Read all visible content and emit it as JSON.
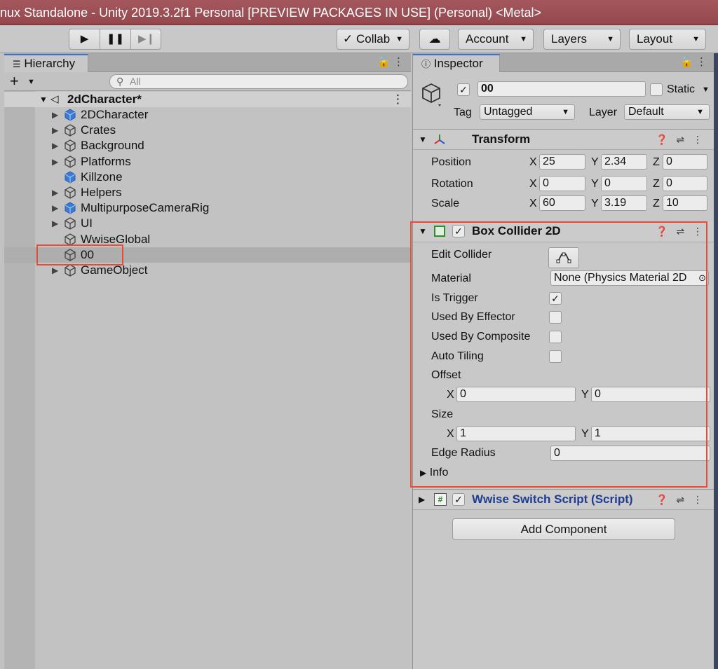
{
  "window": {
    "title": "nux Standalone - Unity 2019.3.2f1 Personal [PREVIEW PACKAGES IN USE] (Personal) <Metal>"
  },
  "toolbar": {
    "play_icon": "play-icon",
    "pause_icon": "pause-icon",
    "step_icon": "step-icon",
    "collab": "Collab",
    "cloud_icon": "cloud-icon",
    "account": "Account",
    "layers": "Layers",
    "layout": "Layout"
  },
  "hierarchy": {
    "tab": "Hierarchy",
    "search_placeholder": "All",
    "scene": "2dCharacter*",
    "items": [
      {
        "label": "2DCharacter",
        "icon": "blue-cube-icon",
        "fold": true
      },
      {
        "label": "Crates",
        "icon": "cube-outline-icon",
        "fold": true
      },
      {
        "label": "Background",
        "icon": "cube-outline-icon",
        "fold": true
      },
      {
        "label": "Platforms",
        "icon": "cube-outline-icon",
        "fold": true
      },
      {
        "label": "Killzone",
        "icon": "blue-cube-icon",
        "fold": false
      },
      {
        "label": "Helpers",
        "icon": "cube-outline-icon",
        "fold": true
      },
      {
        "label": "MultipurposeCameraRig",
        "icon": "blue-cube-icon",
        "fold": true
      },
      {
        "label": "UI",
        "icon": "cube-outline-icon",
        "fold": true
      },
      {
        "label": "WwiseGlobal",
        "icon": "cube-outline-icon",
        "fold": false
      },
      {
        "label": "00",
        "icon": "cube-outline-icon",
        "fold": false
      },
      {
        "label": "GameObject",
        "icon": "cube-outline-icon",
        "fold": true
      }
    ]
  },
  "inspector": {
    "tab": "Inspector",
    "name": "00",
    "static": "Static",
    "tag_label": "Tag",
    "tag": "Untagged",
    "layer_label": "Layer",
    "layer": "Default",
    "transform": {
      "title": "Transform",
      "position": {
        "label": "Position",
        "x": "25",
        "y": "2.34",
        "z": "0"
      },
      "rotation": {
        "label": "Rotation",
        "x": "0",
        "y": "0",
        "z": "0"
      },
      "scale": {
        "label": "Scale",
        "x": "60",
        "y": "3.19",
        "z": "10"
      }
    },
    "box_collider": {
      "title": "Box Collider 2D",
      "edit_collider": "Edit Collider",
      "material_label": "Material",
      "material": "None (Physics Material 2D",
      "is_trigger": "Is Trigger",
      "used_by_effector": "Used By Effector",
      "used_by_composite": "Used By Composite",
      "auto_tiling": "Auto Tiling",
      "offset": "Offset",
      "offset_x": "0",
      "offset_y": "0",
      "size": "Size",
      "size_x": "1",
      "size_y": "1",
      "edge_radius_label": "Edge Radius",
      "edge_radius": "0",
      "info": "Info"
    },
    "script": {
      "title": "Wwise Switch Script (Script)"
    },
    "add_component": "Add Component",
    "axis": {
      "x": "X",
      "y": "Y",
      "z": "Z"
    }
  },
  "colors": {
    "accent": "#3a72d8",
    "highlight": "#e74c36",
    "title_bar": "#9c4f55",
    "script_title": "#1e3d8f"
  }
}
